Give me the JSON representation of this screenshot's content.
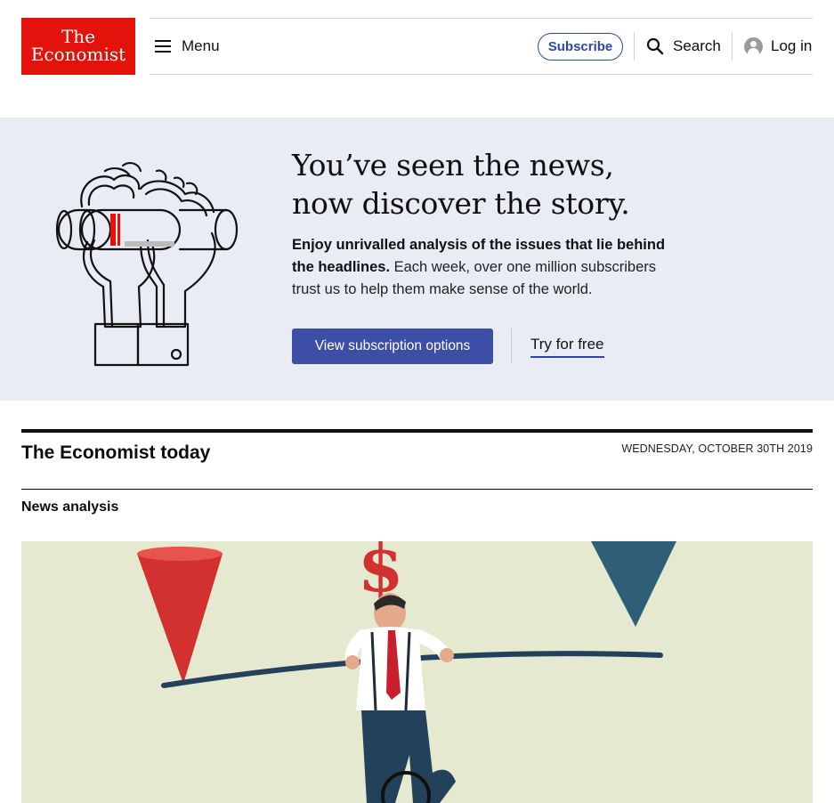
{
  "header": {
    "logo": {
      "line1": "The",
      "line2": "Economist",
      "color": "#e3120b"
    },
    "menu_label": "Menu",
    "subscribe_label": "Subscribe",
    "search_label": "Search",
    "login_label": "Log in"
  },
  "promo": {
    "heading_line1": "You’ve seen the news,",
    "heading_line2": "now discover the story.",
    "body_bold": "Enjoy unrivalled analysis of the issues that lie behind the headlines.",
    "body_rest": " Each week, over one million subscribers trust us to help them make sense of the world.",
    "cta_primary": "View subscription options",
    "cta_secondary": "Try for free",
    "background": "#e9ecf4",
    "button_color": "#3c4ea6"
  },
  "today": {
    "title": "The Economist today",
    "date": "WEDNESDAY, OCTOBER 30TH 2019",
    "section_label": "News analysis"
  },
  "icons": [
    "menu-icon",
    "search-icon",
    "user-avatar-icon",
    "binoculars-hands-illustration"
  ],
  "colors": {
    "brand_red": "#e3120b",
    "accent_blue": "#2e45b8"
  }
}
